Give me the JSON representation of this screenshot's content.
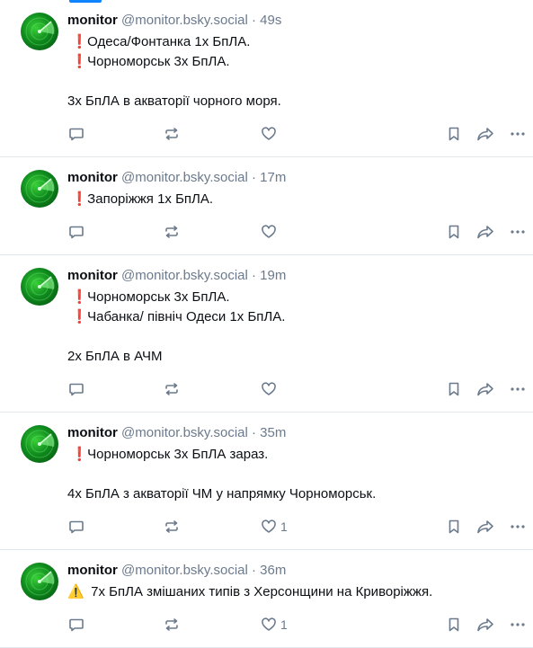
{
  "posts": [
    {
      "name": "monitor",
      "handle": "@monitor.bsky.social",
      "time": "· 49s",
      "lines": [
        {
          "icon": "exclamation",
          "text": "Одеса/Фонтанка 1х БпЛА."
        },
        {
          "icon": "exclamation",
          "text": "Чорноморськ 3х БпЛА."
        },
        {
          "icon": "",
          "text": ""
        },
        {
          "icon": "",
          "text": "3х БпЛА в акваторії чорного моря."
        }
      ],
      "likes": ""
    },
    {
      "name": "monitor",
      "handle": "@monitor.bsky.social",
      "time": "· 17m",
      "lines": [
        {
          "icon": "exclamation",
          "text": "Запоріжжя 1х БпЛА."
        }
      ],
      "likes": ""
    },
    {
      "name": "monitor",
      "handle": "@monitor.bsky.social",
      "time": "· 19m",
      "lines": [
        {
          "icon": "exclamation",
          "text": "Чорноморськ 3х БпЛА."
        },
        {
          "icon": "exclamation",
          "text": "Чабанка/ північ Одеси 1х БпЛА."
        },
        {
          "icon": "",
          "text": ""
        },
        {
          "icon": "",
          "text": "2х БпЛА в АЧМ"
        }
      ],
      "likes": ""
    },
    {
      "name": "monitor",
      "handle": "@monitor.bsky.social",
      "time": "· 35m",
      "lines": [
        {
          "icon": "exclamation",
          "text": "Чорноморськ 3х БпЛА зараз."
        },
        {
          "icon": "",
          "text": ""
        },
        {
          "icon": "",
          "text": "4х БпЛА з акваторії ЧМ у напрямку Чорноморськ."
        }
      ],
      "likes": "1"
    },
    {
      "name": "monitor",
      "handle": "@monitor.bsky.social",
      "time": "· 36m",
      "lines": [
        {
          "icon": "warning",
          "text": "7х БпЛА змішаних типів з Херсонщини на Криворіжжя."
        }
      ],
      "likes": "1"
    }
  ],
  "icons": {
    "exclamation": "❗",
    "warning": "⚠️"
  },
  "colors": {
    "accent": "#1083fe",
    "name": "#0b0f14",
    "muted": "#6b7a8c",
    "exclamation": "#dc1e4a",
    "warning": "#f0b429",
    "divider": "#e3e8ee"
  }
}
